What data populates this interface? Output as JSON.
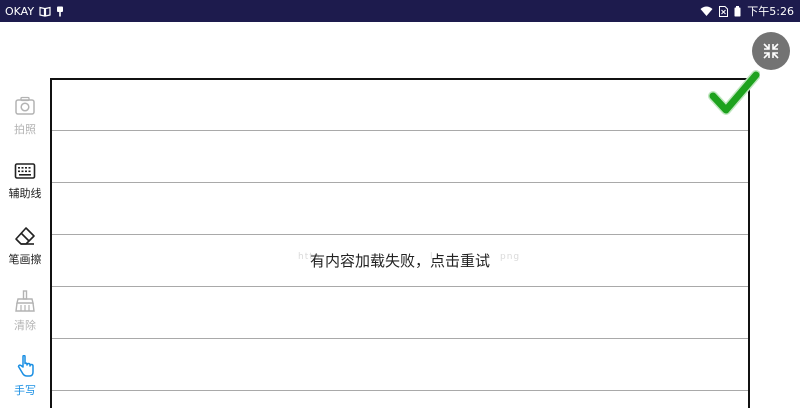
{
  "status_bar": {
    "app_name": "OKAY",
    "time": "下午5:26"
  },
  "toolbar": {
    "items": [
      {
        "label": "拍照",
        "icon": "camera-icon",
        "state": "disabled"
      },
      {
        "label": "辅助线",
        "icon": "keyboard-icon",
        "state": "normal"
      },
      {
        "label": "笔画擦",
        "icon": "eraser-icon",
        "state": "normal"
      },
      {
        "label": "清除",
        "icon": "broom-icon",
        "state": "disabled"
      },
      {
        "label": "手写",
        "icon": "hand-pointer-icon",
        "state": "active"
      }
    ]
  },
  "canvas": {
    "error_message": "有内容加载失败，点击重试",
    "watermark_left": "http",
    "watermark_mid": "l",
    "watermark_right": "png"
  },
  "controls": {
    "fullscreen_icon": "collapse-arrows-icon",
    "confirm_icon": "checkmark-icon"
  },
  "colors": {
    "status_bar": "#1d1b4d",
    "accent": "#1a8fe3",
    "confirm": "#1ea21e",
    "disabled": "#b3b3b3"
  }
}
